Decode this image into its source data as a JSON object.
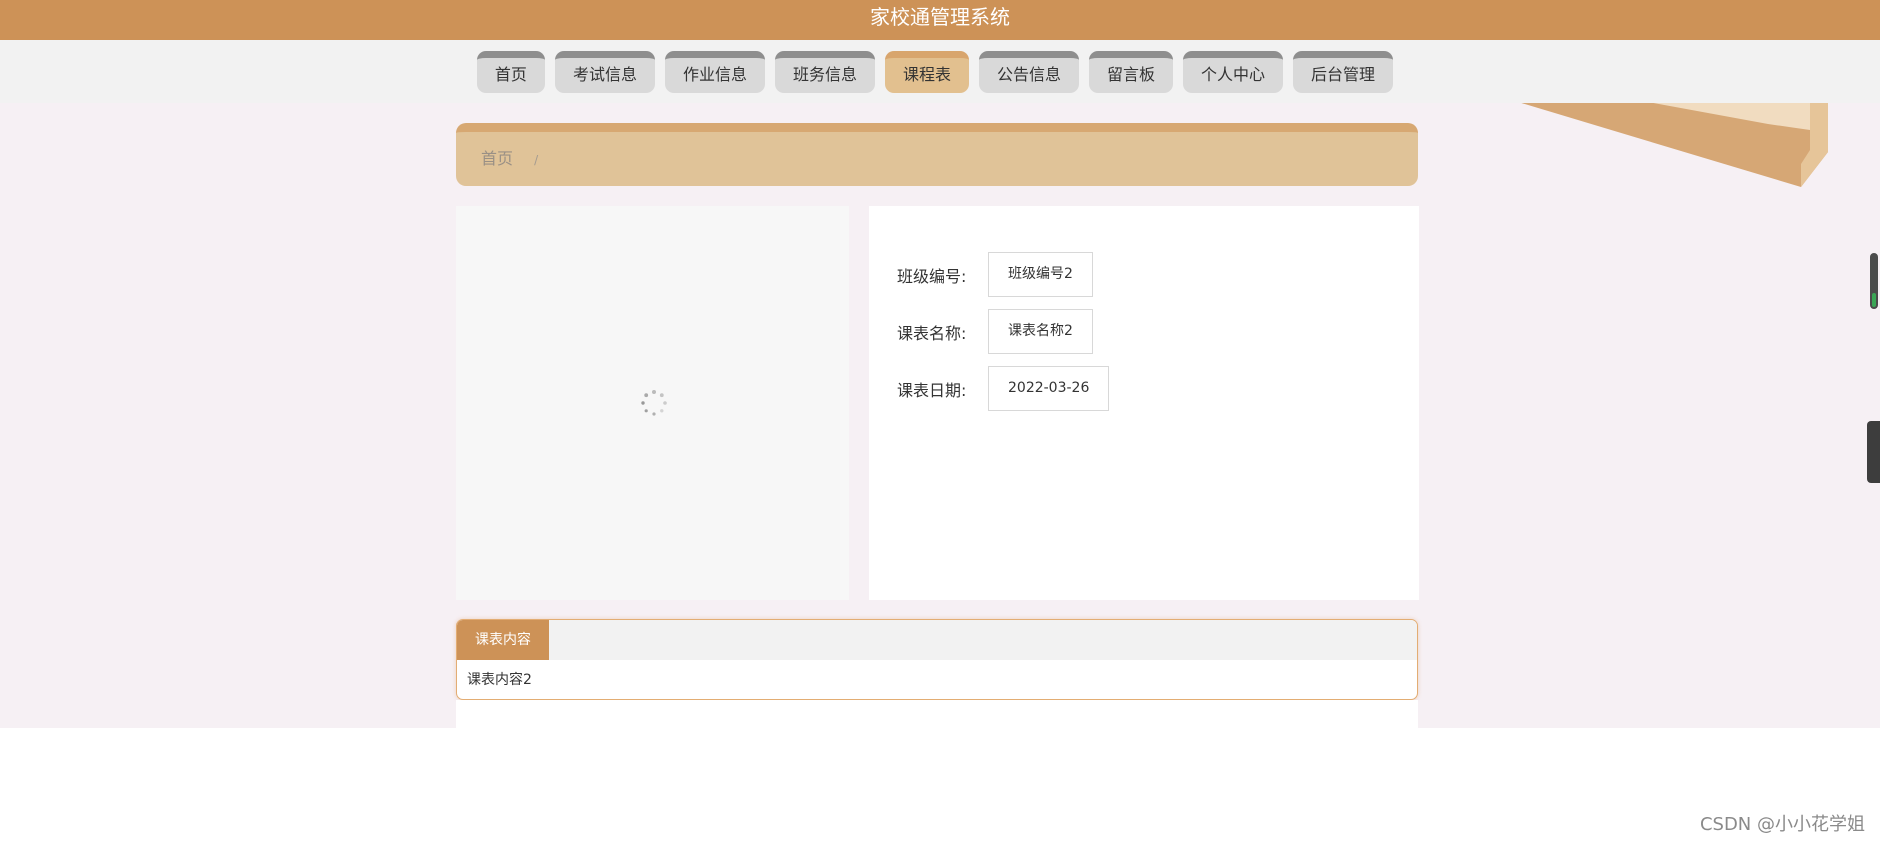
{
  "header": {
    "title": "家校通管理系统"
  },
  "nav": {
    "items": [
      {
        "label": "首页"
      },
      {
        "label": "考试信息"
      },
      {
        "label": "作业信息"
      },
      {
        "label": "班务信息"
      },
      {
        "label": "课程表",
        "active": true
      },
      {
        "label": "公告信息"
      },
      {
        "label": "留言板"
      },
      {
        "label": "个人中心"
      },
      {
        "label": "后台管理"
      }
    ]
  },
  "breadcrumb": {
    "home": "首页",
    "separator": "/"
  },
  "detail": {
    "class_no_label": "班级编号:",
    "class_no_value": "班级编号2",
    "name_label": "课表名称:",
    "name_value": "课表名称2",
    "date_label": "课表日期:",
    "date_value": "2022-03-26"
  },
  "tabs": {
    "active_label": "课表内容",
    "content": "课表内容2"
  },
  "watermark": "CSDN @小小花学姐",
  "colors": {
    "brand": "#cd9257",
    "nav_active": "#e2c08f",
    "page_bg": "#f6f0f4"
  }
}
